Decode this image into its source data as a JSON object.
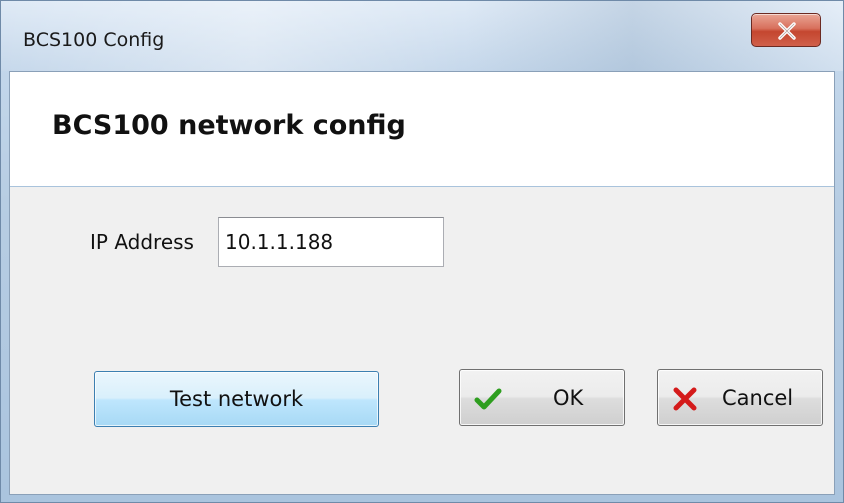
{
  "window": {
    "title": "BCS100 Config",
    "close_icon": "close-icon"
  },
  "header": {
    "title": "BCS100 network config"
  },
  "form": {
    "ip_label": "IP Address",
    "ip_value": "10.1.1.188"
  },
  "buttons": {
    "test_label": "Test network",
    "ok_label": "OK",
    "ok_icon": "checkmark-icon",
    "cancel_label": "Cancel",
    "cancel_icon": "red-x-icon"
  },
  "colors": {
    "checkmark": "#2e9e1f",
    "cancel_x": "#d41a1a",
    "close_button": "#c4462f",
    "focus_button_border": "#3c7fb1"
  }
}
